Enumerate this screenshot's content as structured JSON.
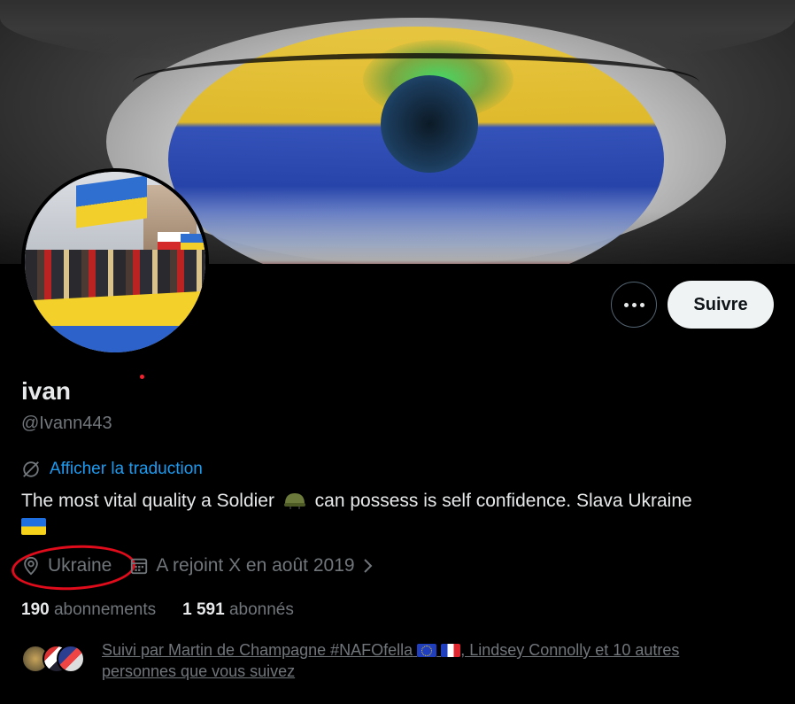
{
  "banner": {
    "description_icon": "eye-ukraine-flag-banner"
  },
  "profile": {
    "name": "ivan",
    "handle": "@Ivann443",
    "translate_label": "Afficher la traduction",
    "bio_part1": "The most vital quality a Soldier",
    "bio_part2": "can possess is self confidence. Slava Ukraine",
    "location": "Ukraine",
    "joined": "A rejoint X en août 2019"
  },
  "actions": {
    "follow_label": "Suivre"
  },
  "stats": {
    "following_count": "190",
    "following_label": "abonnements",
    "followers_count": "1 591",
    "followers_label": "abonnés"
  },
  "followed_by": {
    "part1": "Suivi par Martin de Champagne #NAFOfella",
    "part2": ", Lindsey Connolly et 10 autres personnes que vous suivez"
  },
  "colors": {
    "background": "#000000",
    "link": "#1d9bf0",
    "muted": "#71767b",
    "annotation": "#e00b1b"
  }
}
